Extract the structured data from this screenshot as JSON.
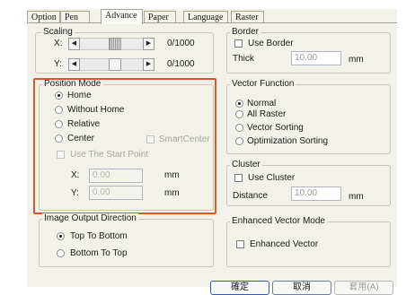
{
  "tabs": [
    "Option",
    "Pen",
    "Advance",
    "Paper",
    "Language",
    "Raster"
  ],
  "scaling": {
    "legend": "Scaling",
    "x_label": "X:",
    "x_value": "0/1000",
    "y_label": "Y:",
    "y_value": "0/1000"
  },
  "position_mode": {
    "legend": "Position Mode",
    "home": "Home",
    "without_home": "Without Home",
    "relative": "Relative",
    "center": "Center",
    "smart_center": "SmartCenter",
    "use_start_point": "Use The Start Point",
    "x_label": "X:",
    "x_value": "0.00",
    "y_label": "Y:",
    "y_value": "0.00",
    "unit": "mm"
  },
  "image_output": {
    "legend": "Image Output Direction",
    "top_to_bottom": "Top To Bottom",
    "bottom_to_top": "Bottom To Top"
  },
  "border": {
    "legend": "Border",
    "use_border": "Use Border",
    "thick_label": "Thick",
    "thick_value": "10.00",
    "unit": "mm"
  },
  "vector_function": {
    "legend": "Vector Function",
    "normal": "Normal",
    "all_raster": "All Raster",
    "vector_sorting": "Vector Sorting",
    "optimization_sorting": "Optimization Sorting"
  },
  "cluster": {
    "legend": "Cluster",
    "use_cluster": "Use Cluster",
    "distance_label": "Distance",
    "distance_value": "10.00",
    "unit": "mm"
  },
  "enhanced_vector": {
    "legend": "Enhanced Vector Mode",
    "enhanced_vector": "Enhanced Vector"
  },
  "buttons": {
    "ok": "確定",
    "cancel": "取消",
    "apply": "套用(A)"
  },
  "colors": {
    "dialog_bg": "#f2f1ea",
    "highlight": "#e2552b",
    "button_border": "#6f7d98"
  }
}
